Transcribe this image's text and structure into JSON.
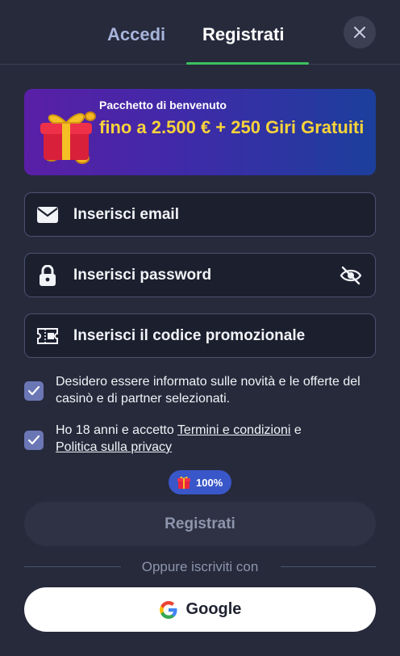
{
  "tabs": {
    "login": "Accedi",
    "register": "Registrati"
  },
  "colors": {
    "accent": "#3cc25f",
    "banner_text": "#f8d33a",
    "checkbox": "#6b76b5",
    "badge": "#3a57c9"
  },
  "banner": {
    "subtitle": "Pacchetto di benvenuto",
    "title": "fino a 2.500 € + 250 Giri Gratuiti"
  },
  "form": {
    "email_placeholder": "Inserisci email",
    "password_placeholder": "Inserisci password",
    "promo_placeholder": "Inserisci il codice promozionale"
  },
  "consents": {
    "news": {
      "checked": true,
      "text": "Desidero essere informato sulle novità e le offerte del casinò e di partner selezionati."
    },
    "terms": {
      "checked": true,
      "prefix": "Ho 18 anni e accetto ",
      "terms_link": "Termini e condizioni",
      "middle": " e",
      "privacy_link": "Politica sulla privacy"
    }
  },
  "badge": {
    "value": "100%",
    "icon": "gift-icon"
  },
  "submit_label": "Registrati",
  "divider_text": "Oppure iscriviti con",
  "google_label": "Google",
  "icons": [
    "close-icon",
    "gift-icon",
    "mail-icon",
    "lock-icon",
    "eye-off-icon",
    "ticket-icon",
    "check-icon",
    "google-icon"
  ]
}
